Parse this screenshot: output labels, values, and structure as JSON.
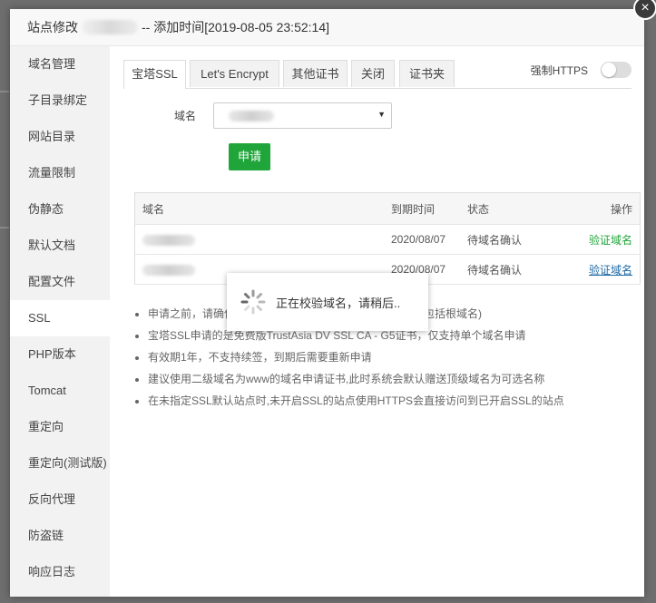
{
  "dialog": {
    "title_prefix": "站点修改",
    "title_suffix": "-- 添加时间[2019-08-05 23:52:14]",
    "close_glyph": "×"
  },
  "sidebar": {
    "items": [
      {
        "label": "域名管理"
      },
      {
        "label": "子目录绑定"
      },
      {
        "label": "网站目录"
      },
      {
        "label": "流量限制"
      },
      {
        "label": "伪静态"
      },
      {
        "label": "默认文档"
      },
      {
        "label": "配置文件"
      },
      {
        "label": "SSL"
      },
      {
        "label": "PHP版本"
      },
      {
        "label": "Tomcat"
      },
      {
        "label": "重定向"
      },
      {
        "label": "重定向(测试版)"
      },
      {
        "label": "反向代理"
      },
      {
        "label": "防盗链"
      },
      {
        "label": "响应日志"
      }
    ],
    "active_index": 7
  },
  "tabs": [
    {
      "label": "宝塔SSL"
    },
    {
      "label": "Let's Encrypt"
    },
    {
      "label": "其他证书"
    },
    {
      "label": "关闭"
    },
    {
      "label": "证书夹"
    }
  ],
  "force_https": {
    "label": "强制HTTPS",
    "enabled": false
  },
  "form": {
    "domain_label": "域名",
    "apply_label": "申请"
  },
  "table": {
    "headers": [
      "域名",
      "到期时间",
      "状态",
      "操作"
    ],
    "rows": [
      {
        "expiry": "2020/08/07",
        "status": "待域名确认",
        "action": "验证域名"
      },
      {
        "expiry": "2020/08/07",
        "status": "待域名确认",
        "action": "验证域名"
      }
    ]
  },
  "notes": [
    "申请之前，请确保域名已解析，如未解析会导致审核失败(包括根域名)",
    "宝塔SSL申请的是免费版TrustAsia DV SSL CA - G5证书，仅支持单个域名申请",
    "有效期1年，不支持续签，到期后需要重新申请",
    "建议使用二级域名为www的域名申请证书,此时系统会默认赠送顶级域名为可选名称",
    "在未指定SSL默认站点时,未开启SSL的站点使用HTTPS会直接访问到已开启SSL的站点"
  ],
  "loading": {
    "message": "正在校验域名，请稍后.."
  },
  "colors": {
    "accent": "#20a53a",
    "link": "#1f6aa5"
  }
}
